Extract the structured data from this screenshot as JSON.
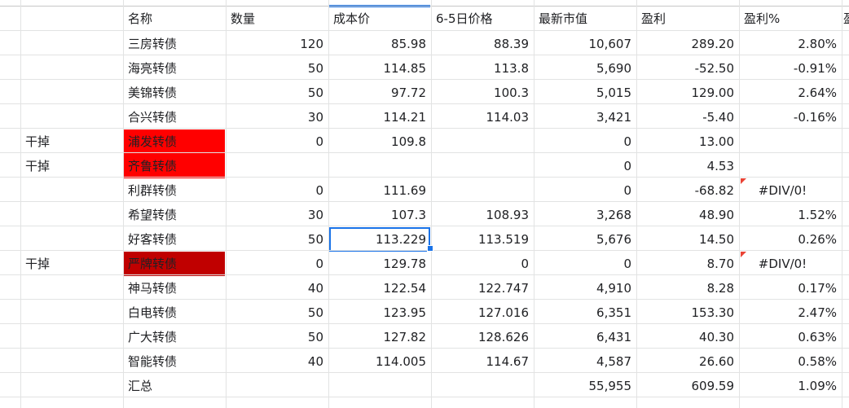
{
  "header": {
    "name": "名称",
    "qty": "数量",
    "cost": "成本价",
    "price": "6-5日价格",
    "mv": "最新市值",
    "pl": "盈利",
    "plpct": "盈利%",
    "extra": "盈"
  },
  "rows": [
    {
      "tag": "",
      "name": "三房转债",
      "qty": "120",
      "cost": "85.98",
      "price": "88.39",
      "mv": "10,607",
      "pl": "289.20",
      "plpct": "2.80%"
    },
    {
      "tag": "",
      "name": "海亮转债",
      "qty": "50",
      "cost": "114.85",
      "price": "113.8",
      "mv": "5,690",
      "pl": "-52.50",
      "plpct": "-0.91%"
    },
    {
      "tag": "",
      "name": "美锦转债",
      "qty": "50",
      "cost": "97.72",
      "price": "100.3",
      "mv": "5,015",
      "pl": "129.00",
      "plpct": "2.64%"
    },
    {
      "tag": "",
      "name": "合兴转债",
      "qty": "30",
      "cost": "114.21",
      "price": "114.03",
      "mv": "3,421",
      "pl": "-5.40",
      "plpct": "-0.16%"
    },
    {
      "tag": "干掉",
      "name": "浦发转债",
      "qty": "0",
      "cost": "109.8",
      "price": "",
      "mv": "0",
      "pl": "13.00",
      "plpct": ""
    },
    {
      "tag": "干掉",
      "name": "齐鲁转债",
      "qty": "",
      "cost": "",
      "price": "",
      "mv": "0",
      "pl": "4.53",
      "plpct": ""
    },
    {
      "tag": "",
      "name": "利群转债",
      "qty": "0",
      "cost": "111.69",
      "price": "",
      "mv": "0",
      "pl": "-68.82",
      "plpct": "#DIV/0!"
    },
    {
      "tag": "",
      "name": "希望转债",
      "qty": "30",
      "cost": "107.3",
      "price": "108.93",
      "mv": "3,268",
      "pl": "48.90",
      "plpct": "1.52%"
    },
    {
      "tag": "",
      "name": "好客转债",
      "qty": "50",
      "cost": "113.229",
      "price": "113.519",
      "mv": "5,676",
      "pl": "14.50",
      "plpct": "0.26%"
    },
    {
      "tag": "干掉",
      "name": "严牌转债",
      "qty": "0",
      "cost": "129.78",
      "price": "0",
      "mv": "0",
      "pl": "8.70",
      "plpct": "#DIV/0!"
    },
    {
      "tag": "",
      "name": "神马转债",
      "qty": "40",
      "cost": "122.54",
      "price": "122.747",
      "mv": "4,910",
      "pl": "8.28",
      "plpct": "0.17%"
    },
    {
      "tag": "",
      "name": "白电转债",
      "qty": "50",
      "cost": "123.95",
      "price": "127.016",
      "mv": "6,351",
      "pl": "153.30",
      "plpct": "2.47%"
    },
    {
      "tag": "",
      "name": "广大转债",
      "qty": "50",
      "cost": "127.82",
      "price": "128.626",
      "mv": "6,431",
      "pl": "40.30",
      "plpct": "0.63%"
    },
    {
      "tag": "",
      "name": "智能转债",
      "qty": "40",
      "cost": "114.005",
      "price": "114.67",
      "mv": "4,587",
      "pl": "26.60",
      "plpct": "0.58%"
    },
    {
      "tag": "",
      "name": "汇总",
      "qty": "",
      "cost": "",
      "price": "",
      "mv": "55,955",
      "pl": "609.59",
      "plpct": "1.09%"
    }
  ],
  "colors": {
    "highlight_red": "#ff0000",
    "highlight_dark_red": "#c00000",
    "selection": "#1a73e8",
    "note_marker": "#ea4335"
  }
}
